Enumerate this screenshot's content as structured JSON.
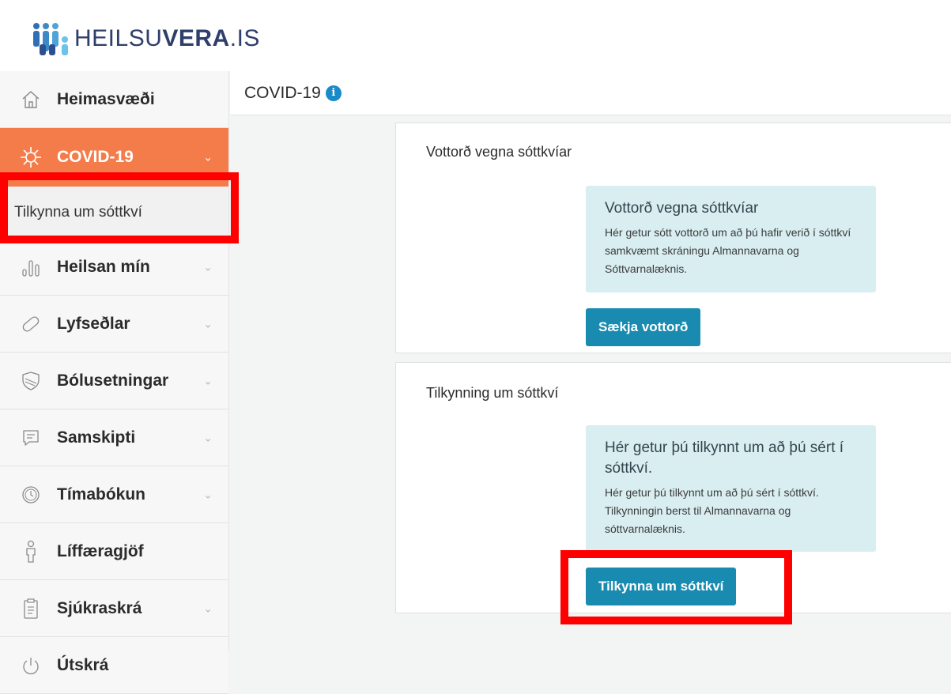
{
  "logo": {
    "prefix": "HEILSU",
    "bold": "VERA",
    "suffix": ".IS"
  },
  "sidebar": {
    "items": [
      {
        "label": "Heimasvæði",
        "icon": "home-icon",
        "chevron": false
      },
      {
        "label": "COVID-19",
        "icon": "virus-icon",
        "chevron": true,
        "active": true
      },
      {
        "label": "Heilsan mín",
        "icon": "bar-chart-icon",
        "chevron": true
      },
      {
        "label": "Lyfseðlar",
        "icon": "pill-icon",
        "chevron": true
      },
      {
        "label": "Bólusetningar",
        "icon": "shield-icon",
        "chevron": true
      },
      {
        "label": "Samskipti",
        "icon": "chat-icon",
        "chevron": true
      },
      {
        "label": "Tímabókun",
        "icon": "clock-icon",
        "chevron": true
      },
      {
        "label": "Líffæragjöf",
        "icon": "person-icon",
        "chevron": false
      },
      {
        "label": "Sjúkraskrá",
        "icon": "document-icon",
        "chevron": true
      },
      {
        "label": "Útskrá",
        "icon": "power-icon",
        "chevron": false
      }
    ],
    "subitem": "Tilkynna um sóttkví"
  },
  "topbar": {
    "title": "COVID-19",
    "info_glyph": "i"
  },
  "card1": {
    "title": "Vottorð vegna sóttkvíar",
    "box_heading": "Vottorð vegna sóttkvíar",
    "box_text": "Hér getur sótt vottorð um að þú hafir verið í sóttkví samkvæmt skráningu Almannavarna og Sóttvarnalæknis.",
    "button": "Sækja vottorð"
  },
  "card2": {
    "title": "Tilkynning um sóttkví",
    "box_heading": "Hér getur þú tilkynnt um að þú sért í sóttkví.",
    "box_text": "Hér getur þú tilkynnt um að þú sért í sóttkví. Tilkynningin berst til Almannavarna og sóttvarnalæknis.",
    "button": "Tilkynna um sóttkví"
  },
  "colors": {
    "accent": "#f47c4b",
    "button": "#1a8bb0",
    "info_box": "#d9eef1",
    "highlight": "#ff0000",
    "brand": "#2f3f6b"
  }
}
